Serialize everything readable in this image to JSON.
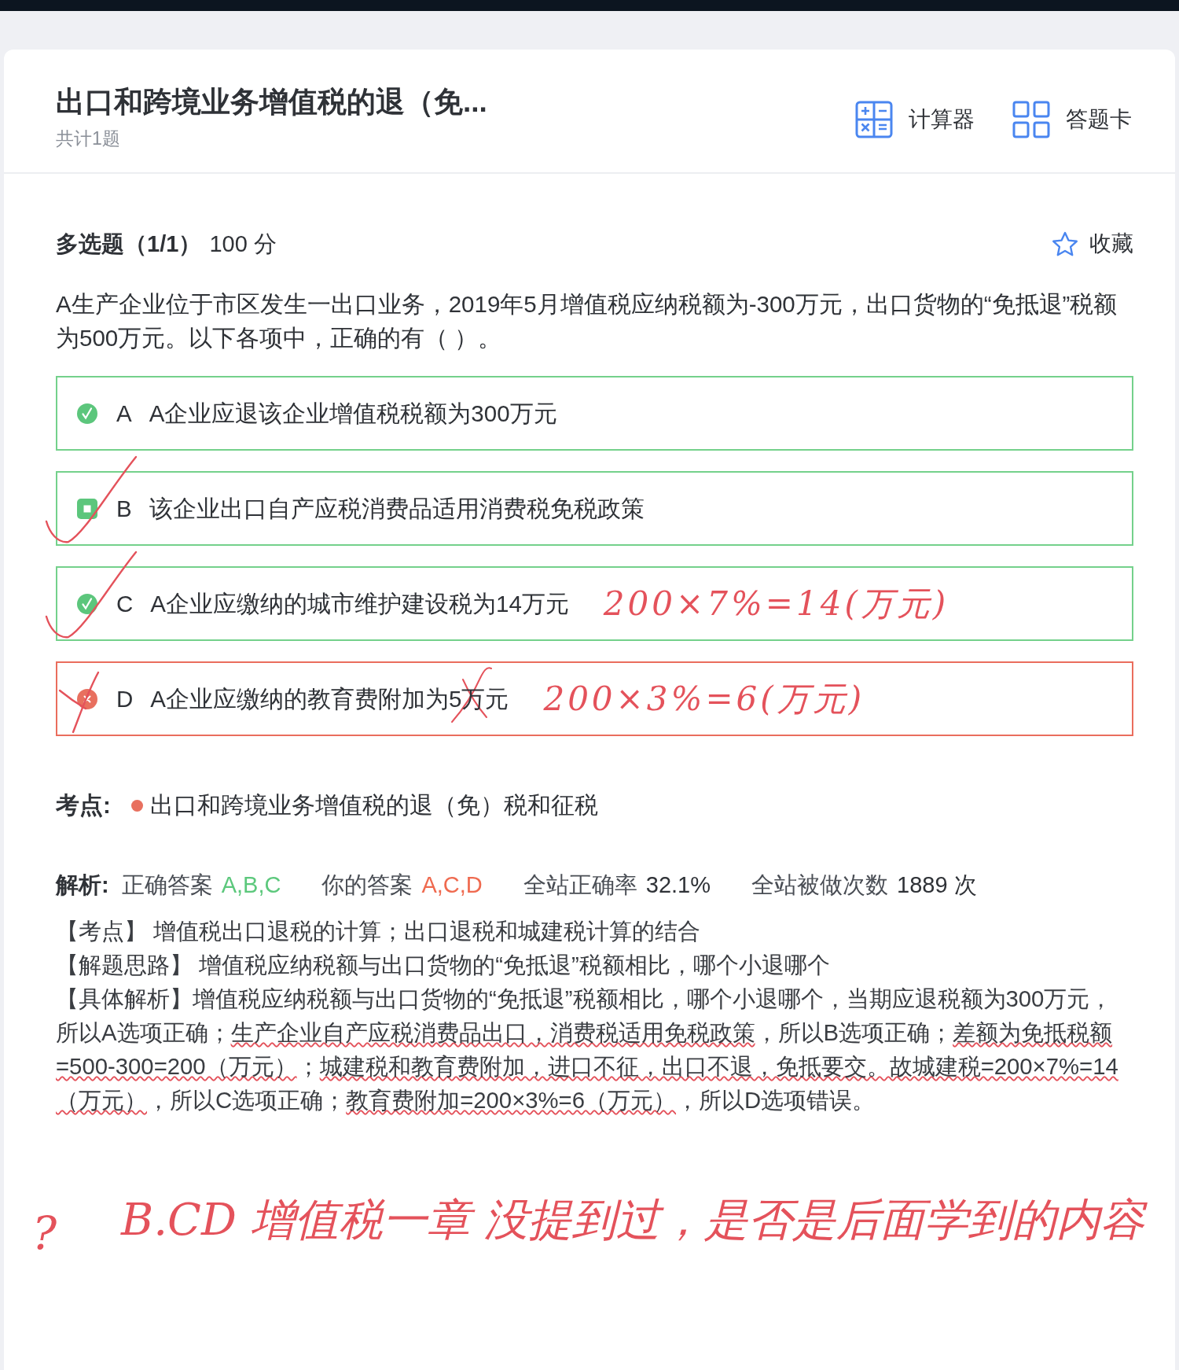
{
  "header": {
    "title": "出口和跨境业务增值税的退（免...",
    "count": "共计1题",
    "tools": [
      {
        "kind": "calculator",
        "label": "计算器"
      },
      {
        "kind": "answer_sheet",
        "label": "答题卡"
      }
    ]
  },
  "question": {
    "type_label": "多选题（1/1）",
    "score": "100 分",
    "favorite": {
      "label": "收藏",
      "on": false
    },
    "text": "A生产企业位于市区发生一出口业务，2019年5月增值税应纳税额为-300万元，出口货物的“免抵退”税额为500万元。以下各项中，正确的有（ ）。",
    "options": [
      {
        "letter": "A",
        "text": "A企业应退该企业增值税税额为300万元",
        "correct": true,
        "selected": true,
        "ink_check": false,
        "ink_cross": false,
        "text_struck": false
      },
      {
        "letter": "B",
        "text": "该企业出口自产应税消费品适用消费税免税政策",
        "correct": true,
        "selected": false,
        "ink_check": true,
        "ink_cross": false,
        "text_struck": false
      },
      {
        "letter": "C",
        "text": "A企业应缴纳的城市维护建设税为14万元",
        "correct": true,
        "selected": true,
        "ink_check": true,
        "ink_cross": false,
        "text_struck": false,
        "note": "200×7%=14(万元)"
      },
      {
        "letter": "D",
        "text": "A企业应缴纳的教育费附加为5万元",
        "correct": false,
        "selected": true,
        "ink_check": false,
        "ink_cross": true,
        "text_struck": true,
        "note": "200×3%=6(万元)"
      }
    ]
  },
  "topic": {
    "label": "考点:",
    "items": [
      "出口和跨境业务增值税的退（免）税和征税"
    ]
  },
  "analysis": {
    "label": "解析:",
    "stats": [
      {
        "kind": "correct",
        "label": "正确答案",
        "value": "A,B,C"
      },
      {
        "kind": "yours",
        "label": "你的答案",
        "value": "A,C,D"
      },
      {
        "kind": "plain",
        "label": "全站正确率",
        "value": "32.1%"
      },
      {
        "kind": "plain",
        "label": "全站被做次数",
        "value": "1889 次"
      }
    ],
    "paragraphs": [
      [
        {
          "text": "【考点】 增值税出口退税的计算；出口退税和城建税计算的结合",
          "marked": false
        }
      ],
      [
        {
          "text": "【解题思路】 增值税应纳税额与出口货物的“免抵退”税额相比，哪个小退哪个",
          "marked": false
        }
      ],
      [
        {
          "text": "【具体解析】增值税应纳税额与出口货物的“免抵退”税额相比，哪个小退哪个，当期应退税额为300万元，所以A选项正确；",
          "marked": false
        },
        {
          "text": "生产企业自产应税消费品出口，消费税适用免税政策",
          "marked": true
        },
        {
          "text": "，所以B选项正确；",
          "marked": false
        },
        {
          "text": "差额为免抵税额=500-300=200（万元）",
          "marked": true
        },
        {
          "text": "；",
          "marked": false
        },
        {
          "text": "城建税和教育费附加，进口不征，出口不退，免抵要交。故城建税=200×7%=14（万元）",
          "marked": true
        },
        {
          "text": "，所以C选项正确；",
          "marked": false
        },
        {
          "text": "教育费附加=200×3%=6（万元）",
          "marked": true
        },
        {
          "text": "，所以D选项错误。",
          "marked": false
        }
      ]
    ]
  },
  "annotation": {
    "mark": "?",
    "text": "B.CD 增值税一章 没提到过，是否是后面学到的内容"
  }
}
